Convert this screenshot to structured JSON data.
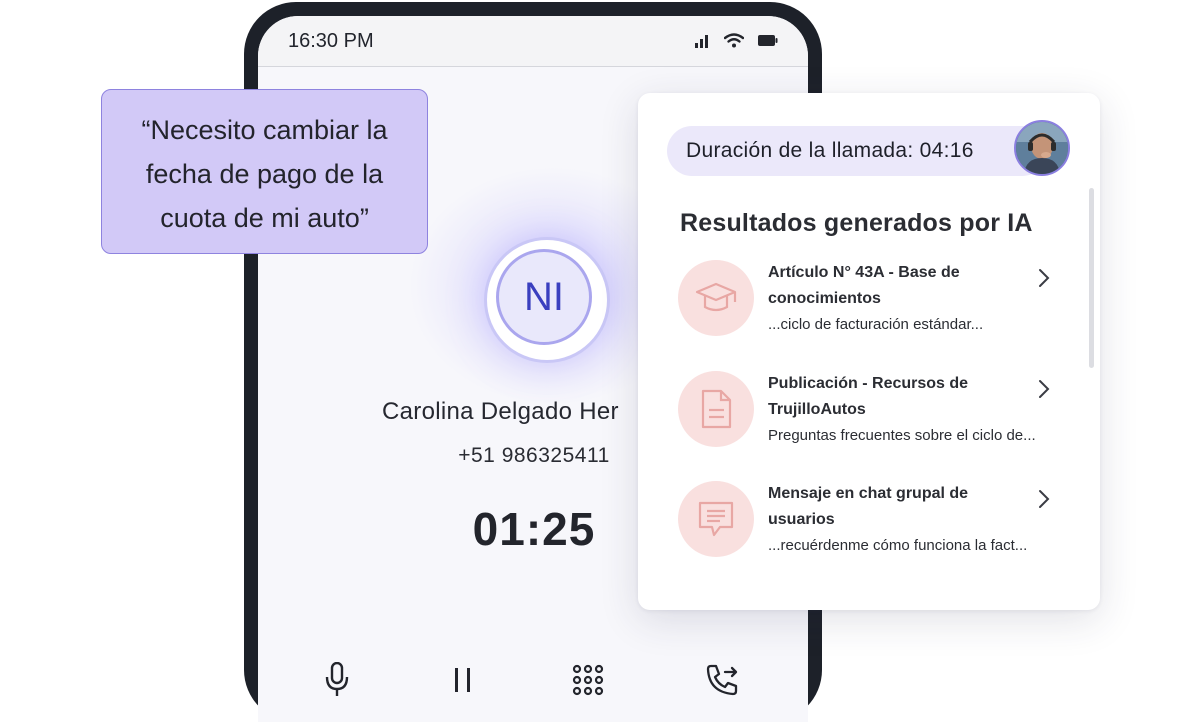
{
  "phone": {
    "status_time": "16:30 PM",
    "avatar_initials": "NI",
    "caller_name": "Carolina Delgado Her",
    "caller_number": "+51 986325411",
    "call_timer": "01:25",
    "status_icons": [
      "cellular-signal-icon",
      "wifi-icon",
      "battery-icon"
    ],
    "controls": [
      "microphone-icon",
      "pause-icon",
      "dialpad-icon",
      "call-transfer-icon"
    ]
  },
  "quote": {
    "text": "“Necesito cambiar la fecha de pago de la cuota de mi auto”"
  },
  "panel": {
    "duration_label": "Duración de la llamada: 04:16",
    "title": "Resultados generados por IA",
    "results": [
      {
        "icon": "graduation-cap-icon",
        "title": "Artículo N° 43A - Base de conocimientos",
        "snippet": "...ciclo de facturación estándar..."
      },
      {
        "icon": "document-icon",
        "title": "Publicación - Recursos de TrujilloAutos",
        "snippet": "Preguntas frecuentes sobre el ciclo de..."
      },
      {
        "icon": "chat-message-icon",
        "title": "Mensaje en chat grupal de usuarios",
        "snippet": "...recuérdenme cómo funciona la fact..."
      }
    ]
  },
  "colors": {
    "accent_purple": "#8e83df",
    "quote_bg": "#d2c9f7",
    "pill_bg": "#ebe8fa",
    "icon_bg": "#f9e0df",
    "icon_stroke": "#e8a7a4",
    "phone_frame": "#1d2129"
  }
}
